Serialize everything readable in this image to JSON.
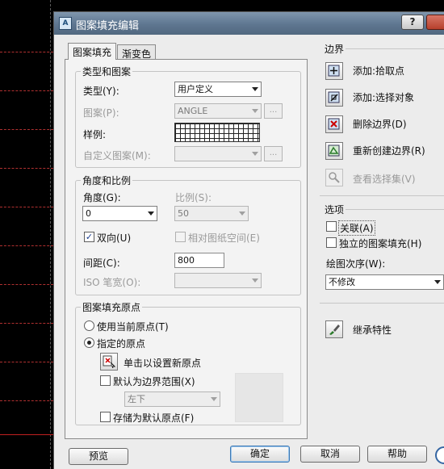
{
  "window": {
    "title": "图案填充编辑",
    "help_label": "?"
  },
  "tabs": [
    {
      "label": "图案填充"
    },
    {
      "label": "渐变色"
    }
  ],
  "type_pattern": {
    "group_label": "类型和图案",
    "type_label": "类型(Y):",
    "type_value": "用户定义",
    "pattern_label": "图案(P):",
    "pattern_value": "ANGLE",
    "sample_label": "样例:",
    "custom_label": "自定义图案(M):",
    "dots_label": "..."
  },
  "angle_scale": {
    "group_label": "角度和比例",
    "angle_label": "角度(G):",
    "angle_value": "0",
    "scale_label": "比例(S):",
    "scale_value": "50",
    "double_label": "双向(U)",
    "double_checked": true,
    "relative_label": "相对图纸空间(E)",
    "spacing_label": "间距(C):",
    "spacing_value": "800",
    "iso_label": "ISO 笔宽(O):"
  },
  "origin": {
    "group_label": "图案填充原点",
    "use_current_label": "使用当前原点(T)",
    "specified_label": "指定的原点",
    "click_set_label": "单击以设置新原点",
    "default_extent_label": "默认为边界范围(X)",
    "extent_value": "左下",
    "store_default_label": "存储为默认原点(F)"
  },
  "boundaries": {
    "label": "边界",
    "add_pick_label": "添加:拾取点",
    "add_select_label": "添加:选择对象",
    "remove_label": "删除边界(D)",
    "recreate_label": "重新创建边界(R)",
    "view_label": "查看选择集(V)"
  },
  "options": {
    "label": "选项",
    "associative_label": "关联(A)",
    "independent_label": "独立的图案填充(H)",
    "draw_order_label": "绘图次序(W):",
    "draw_order_value": "不修改"
  },
  "inherit_label": "继承特性",
  "buttons": {
    "preview": "预览",
    "ok": "确定",
    "cancel": "取消",
    "help": "帮助"
  }
}
